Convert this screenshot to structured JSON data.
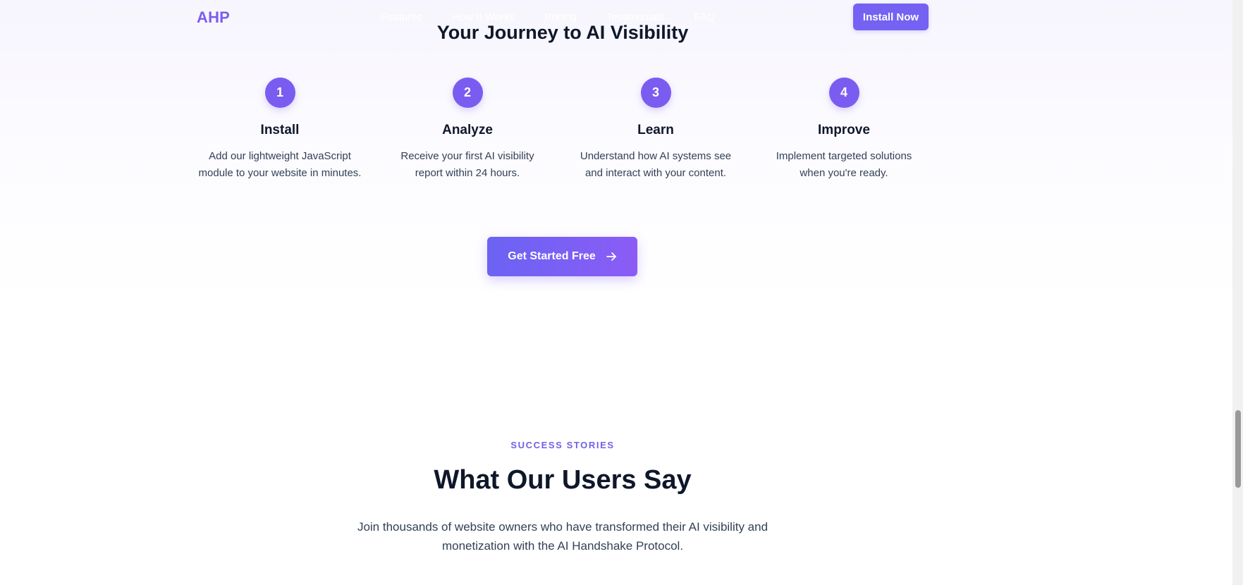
{
  "nav": {
    "logo": "AHP",
    "links": [
      "Features",
      "How It Works",
      "Pricing",
      "Testimonials",
      "FAQ"
    ],
    "install_label": "Install Now"
  },
  "journey": {
    "title": "Your Journey to AI Visibility",
    "steps": [
      {
        "number": "1",
        "title": "Install",
        "desc_line1": "Add our lightweight JavaScript",
        "desc_line2": "module to your website in minutes."
      },
      {
        "number": "2",
        "title": "Analyze",
        "desc_line1": "Receive your first AI visibility",
        "desc_line2": "report within 24 hours."
      },
      {
        "number": "3",
        "title": "Learn",
        "desc_line1": "Understand how AI systems see",
        "desc_line2": "and interact with your content."
      },
      {
        "number": "4",
        "title": "Improve",
        "desc_line1": "Implement targeted solutions",
        "desc_line2": "when you're ready."
      }
    ],
    "cta_label": "Get Started Free"
  },
  "testimonials": {
    "eyebrow": "SUCCESS STORIES",
    "title": "What Our Users Say",
    "subtitle_line1": "Join thousands of website owners who have transformed their AI visibility and",
    "subtitle_line2": "monetization with the AI Handshake Protocol."
  },
  "icons": {
    "cta_arrow": "arrow-right-icon"
  },
  "colors": {
    "accent": "#7561f2",
    "brand_logo": "#7c5cf0",
    "heading": "#0f172a",
    "body_text": "#334155"
  }
}
